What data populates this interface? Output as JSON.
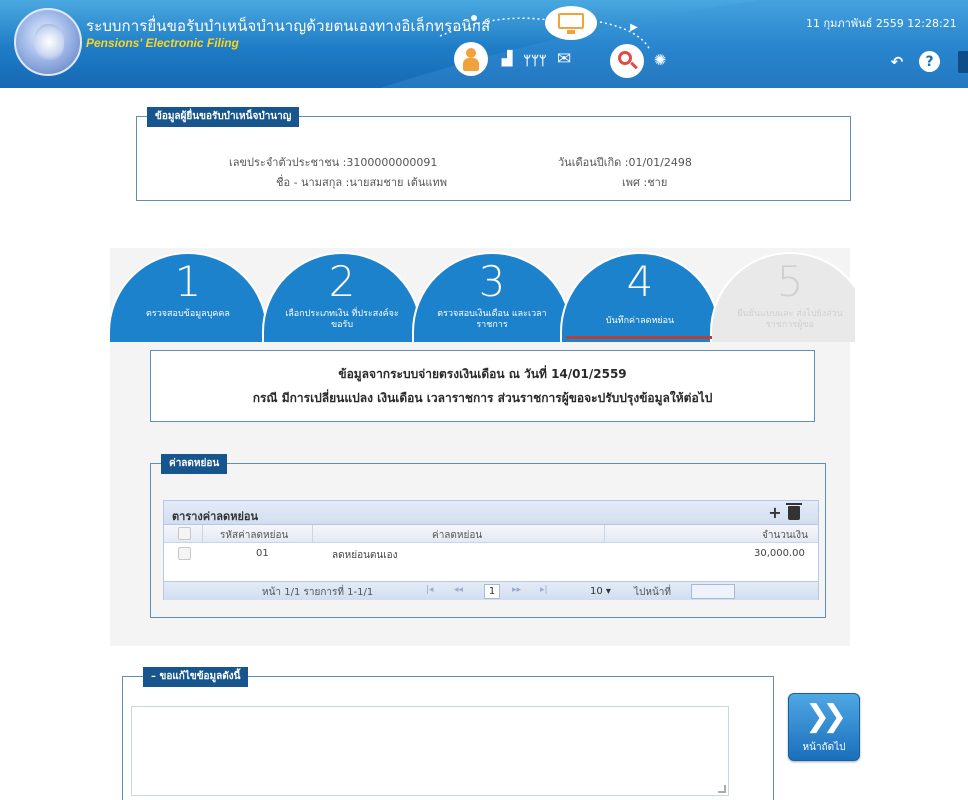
{
  "header": {
    "title_th": "ระบบการยื่นขอรับบำเหน็จบำนาญด้วยตนเองทางอิเล็กทรอนิกส์",
    "title_en": "Pensions' Electronic Filing",
    "datetime": "11 กุมภาพันธ์ 2559 12:28:21",
    "icons": [
      "person-icon",
      "chart-icon",
      "people-icon",
      "mail-icon",
      "monitor-icon",
      "search-icon",
      "bulb-icon"
    ],
    "colors": {
      "bar": "#1e7cc6",
      "title_en": "#ffd31c"
    }
  },
  "personal_info": {
    "legend": "ข้อมูลผู้ยื่นขอรับบำเหน็จบำนาญ",
    "id_label": "เลขประจำตัวประชาชน :",
    "id_value": "3100000000091",
    "name_label": "ชื่อ - นามสกุล :",
    "name_value": "นายสมชาย เต้นแทพ",
    "dob_label": "วันเดือนปีเกิด :",
    "dob_value": "01/01/2498",
    "sex_label": "เพศ :",
    "sex_value": "ชาย"
  },
  "wizard": {
    "active_color": "#1d82cc",
    "steps": [
      {
        "num": "1",
        "label": "ตรวจสอบข้อมูลบุคคล"
      },
      {
        "num": "2",
        "label": "เลือกประเภทเงิน ที่ประสงค์จะขอรับ"
      },
      {
        "num": "3",
        "label": "ตรวจสอบเงินเดือน และเวลาราชการ"
      },
      {
        "num": "4",
        "label": "บันทึกค่าลดหย่อน"
      },
      {
        "num": "5",
        "label": "ยืนยันแบบและ ส่งไปยังส่วนราชการผู้ขอ"
      }
    ]
  },
  "notice": {
    "line1": "ข้อมูลจากระบบจ่ายตรงเงินเดือน ณ วันที่ 14/01/2559",
    "line2": "กรณี มีการเปลี่ยนแปลง เงินเดือน เวลาราชการ ส่วนราชการผู้ขอจะปรับปรุงข้อมูลให้ต่อไป"
  },
  "deductions": {
    "legend": "ค่าลดหย่อน",
    "grid_title": "ตารางค่าลดหย่อน",
    "columns": [
      "รหัสค่าลดหย่อน",
      "ค่าลดหย่อน",
      "จำนวนเงิน"
    ],
    "rows": [
      {
        "code": "01",
        "name": "ลดหย่อนตนเอง",
        "amount": "30,000.00"
      }
    ],
    "pager": {
      "info": "หน้า 1/1 รายการที่ 1-1/1",
      "page": "1",
      "page_size": "10 ▾",
      "goto_label": "ไปหน้าที่"
    }
  },
  "remarks": {
    "legend": "– ขอแก้ไขข้อมูลดังนี้",
    "value": ""
  },
  "next_button": {
    "label": "หน้าถัดไป",
    "glyph": "❯❯"
  }
}
